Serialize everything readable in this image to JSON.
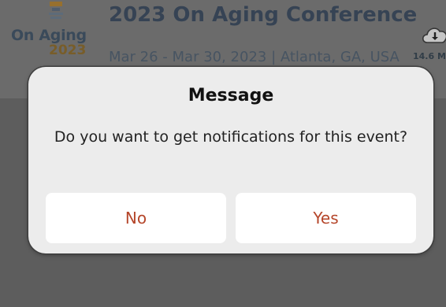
{
  "event": {
    "logo_line1": "On Aging",
    "logo_line2": "2023",
    "title": "2023 On Aging Conference",
    "dates": "Mar 26  -  Mar 30, 2023 | Atlanta, GA, USA",
    "download_size": "14.6 M",
    "download_icon": "cloud-download-icon",
    "logo_icon": "conference-emblem-icon"
  },
  "dialog": {
    "title": "Message",
    "message": "Do you want to get notifications for this event?",
    "no_label": "No",
    "yes_label": "Yes"
  },
  "colors": {
    "accent": "#b5462a",
    "dialog_bg": "#ececec",
    "backdrop": "#6a6a6a"
  }
}
